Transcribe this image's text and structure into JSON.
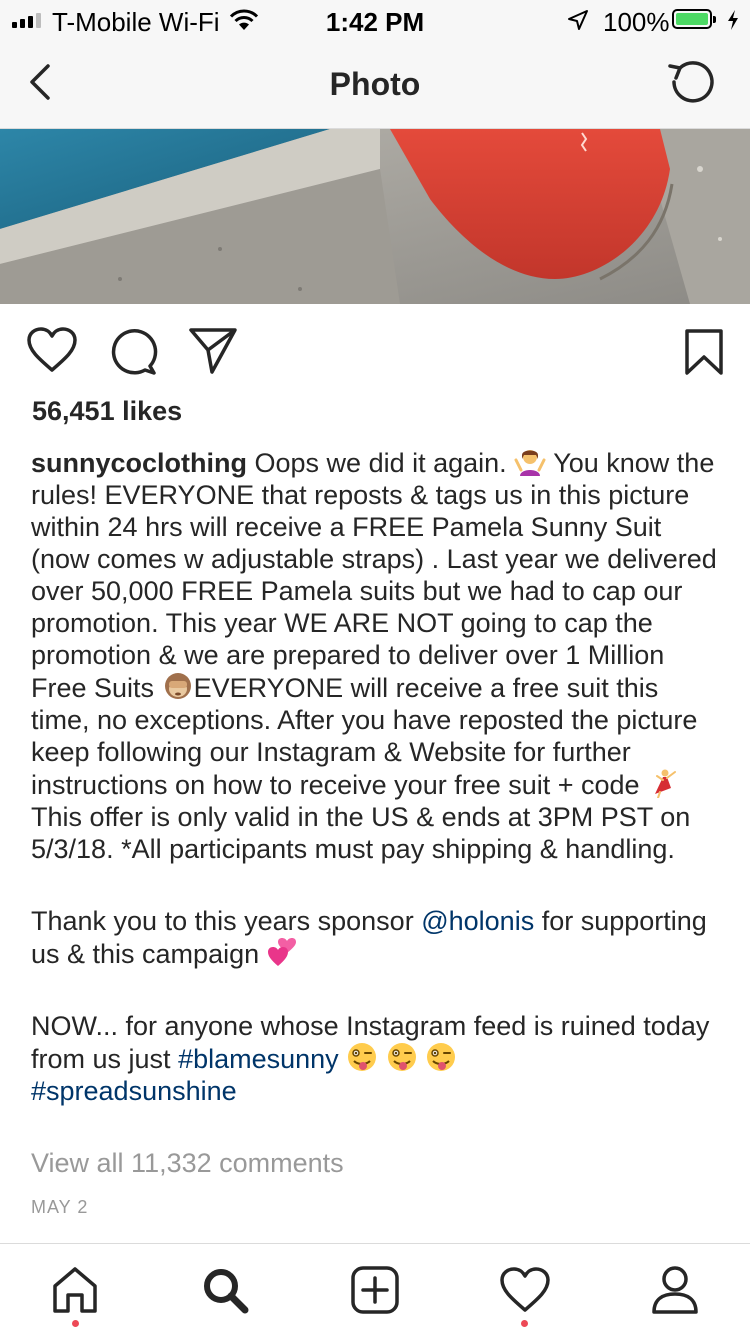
{
  "status_bar": {
    "carrier": "T-Mobile Wi-Fi",
    "time": "1:42 PM",
    "battery": "100%"
  },
  "header": {
    "title": "Photo"
  },
  "post": {
    "likes": "56,451 likes",
    "username": "sunnycoclothing",
    "caption_1": "Oops we did it again.",
    "caption_2": "You know the rules! EVERYONE that reposts & tags us in this picture within 24 hrs will receive a FREE Pamela Sunny Suit (now comes w adjustable straps) . Last year we delivered over 50,000 FREE Pamela suits but we had to cap our promotion. This year WE ARE NOT going to cap the promotion & we are prepared to deliver over 1 Million Free Suits",
    "caption_3": "EVERYONE will receive a free suit this time, no exceptions. After you have reposted the picture keep following our Instagram & Website for further instructions on how to receive your free suit + code",
    "caption_4": "This offer is only valid in the US & ends at 3PM PST on 5/3/18. *All participants must pay shipping & handling.",
    "sponsor_prefix": "Thank you to this years sponsor",
    "sponsor_mention": "@holonis",
    "sponsor_suffix": "for supporting us & this campaign",
    "closing_text": "NOW... for anyone whose Instagram feed is ruined today from us just",
    "hashtag_1": "#blamesunny",
    "hashtag_2": "#spreadsunshine",
    "view_comments": "View all 11,332 comments",
    "date": "MAY 2"
  },
  "icons": {
    "emoji_1": "person-shrugging-emoji",
    "emoji_2": "see-no-evil-monkey-emoji",
    "emoji_3": "dancer-emoji",
    "emoji_4": "two-hearts-emoji",
    "emoji_5": "winking-face-tongue-emoji"
  },
  "colors": {
    "link": "#003569",
    "muted": "#999999",
    "notification_dot": "#ed4956",
    "battery": "#4cd964"
  }
}
